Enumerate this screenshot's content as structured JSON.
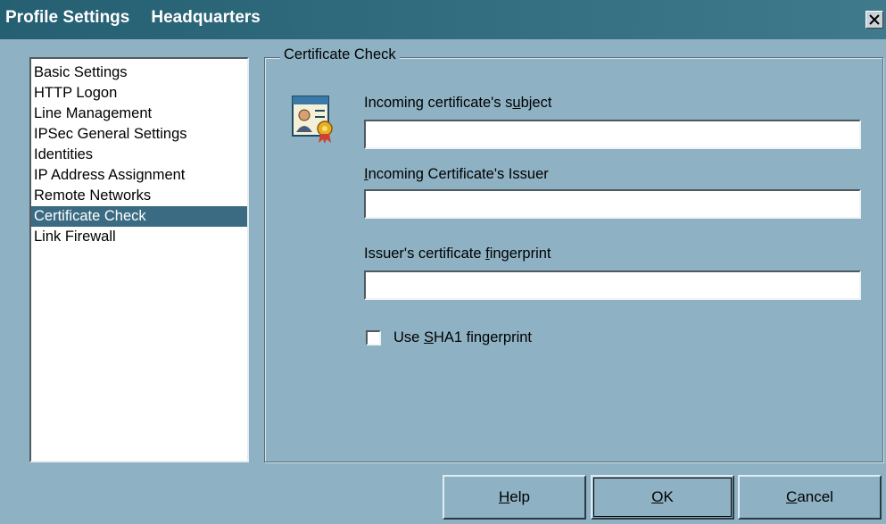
{
  "window": {
    "title": "Profile Settings",
    "subtitle": "Headquarters",
    "close_glyph": "✕"
  },
  "sidebar": {
    "items": [
      {
        "label": "Basic Settings",
        "selected": false
      },
      {
        "label": "HTTP Logon",
        "selected": false
      },
      {
        "label": "Line Management",
        "selected": false
      },
      {
        "label": "IPSec General Settings",
        "selected": false
      },
      {
        "label": "Identities",
        "selected": false
      },
      {
        "label": "IP Address Assignment",
        "selected": false
      },
      {
        "label": "Remote Networks",
        "selected": false
      },
      {
        "label": "Certificate Check",
        "selected": true
      },
      {
        "label": "Link Firewall",
        "selected": false
      }
    ]
  },
  "panel": {
    "group_title": "Certificate Check",
    "icon": "certificate-icon",
    "subject_label": "Incoming certificate's subject",
    "subject_value": "",
    "issuer_label": "Incoming Certificate's Issuer",
    "issuer_value": "",
    "fingerprint_label": "Issuer's certificate fingerprint",
    "fingerprint_value": "",
    "sha1_label": "Use SHA1 fingerprint",
    "sha1_checked": false
  },
  "buttons": {
    "help": "Help",
    "ok": "OK",
    "cancel": "Cancel"
  },
  "colors": {
    "background": "#8eb2c4",
    "titlebar": "#255f72",
    "selection": "#3b6b82"
  }
}
